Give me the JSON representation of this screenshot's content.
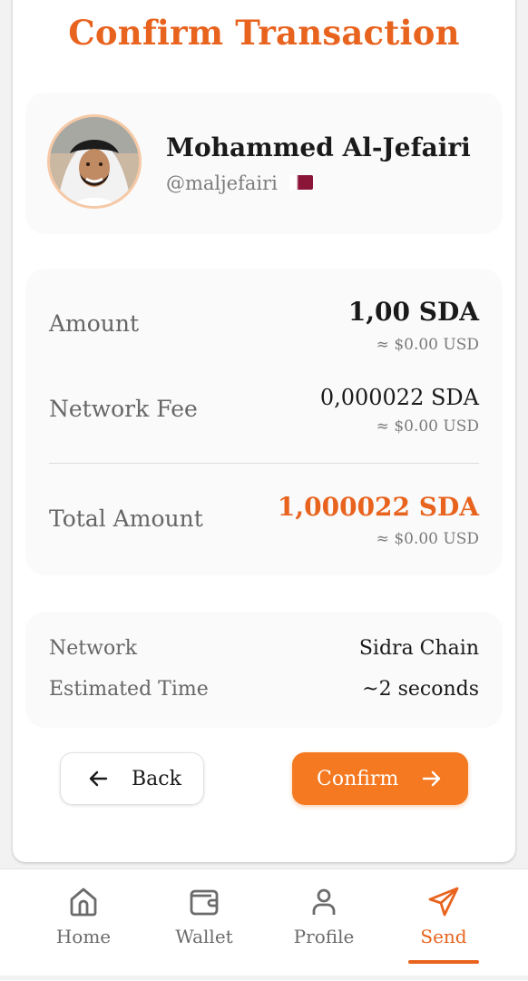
{
  "page": {
    "title": "Confirm Transaction"
  },
  "recipient": {
    "name": "Mohammed Al-Jefairi",
    "handle": "@maljefairi",
    "flag_icon": "qatar-flag-icon"
  },
  "amounts": {
    "amount_label": "Amount",
    "amount_value": "1,00 SDA",
    "amount_usd": "≈ $0.00 USD",
    "fee_label": "Network Fee",
    "fee_value": "0,000022 SDA",
    "fee_usd": "≈ $0.00 USD",
    "total_label": "Total Amount",
    "total_value": "1,000022 SDA",
    "total_usd": "≈ $0.00 USD"
  },
  "details": {
    "network_label": "Network",
    "network_value": "Sidra Chain",
    "time_label": "Estimated Time",
    "time_value": "~2 seconds"
  },
  "actions": {
    "back_label": "Back",
    "back_icon": "arrow-left-icon",
    "confirm_label": "Confirm",
    "confirm_icon": "arrow-right-icon"
  },
  "nav": {
    "items": [
      {
        "label": "Home",
        "icon": "home-icon"
      },
      {
        "label": "Wallet",
        "icon": "wallet-icon"
      },
      {
        "label": "Profile",
        "icon": "user-icon"
      },
      {
        "label": "Send",
        "icon": "send-icon"
      }
    ],
    "active": "Send"
  },
  "colors": {
    "accent": "#e8631e",
    "button": "#f47920",
    "text": "#1a1a1a",
    "muted": "#666666"
  }
}
